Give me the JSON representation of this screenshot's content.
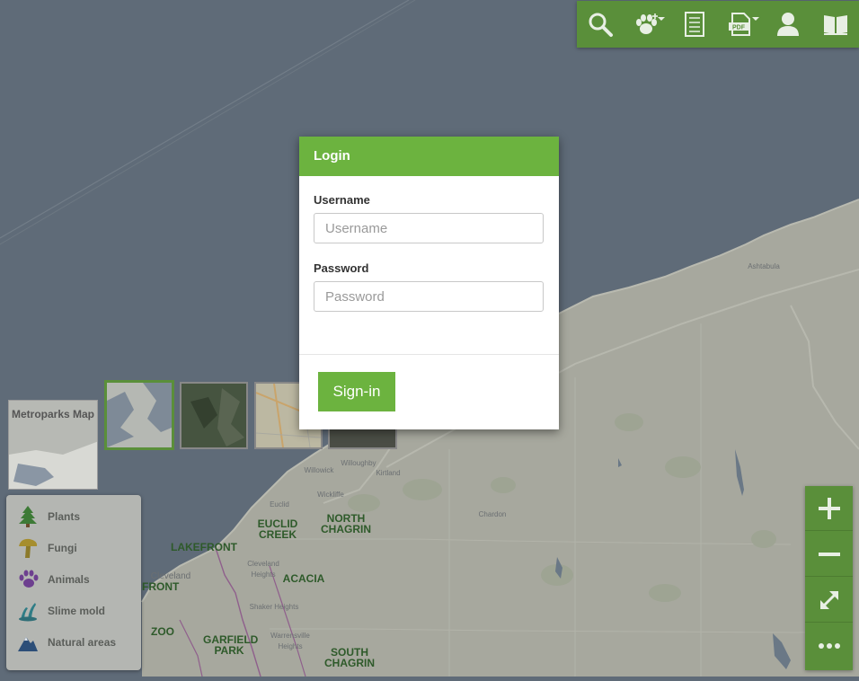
{
  "toolbar": {
    "search_icon": "search-icon",
    "species_icon": "paw-icon",
    "list_icon": "list-icon",
    "pdf_icon": "pdf-icon",
    "user_icon": "user-icon",
    "book_icon": "book-icon"
  },
  "login": {
    "title": "Login",
    "username_label": "Username",
    "username_placeholder": "Username",
    "username_value": "",
    "password_label": "Password",
    "password_placeholder": "Password",
    "password_value": "",
    "signin_label": "Sign-in"
  },
  "basemaps": {
    "metroparks_label": "Metroparks Map"
  },
  "legend": {
    "items": [
      {
        "label": "Plants",
        "icon": "tree-icon"
      },
      {
        "label": "Fungi",
        "icon": "mushroom-icon"
      },
      {
        "label": "Animals",
        "icon": "paw-icon"
      },
      {
        "label": "Slime mold",
        "icon": "slime-mold-icon"
      },
      {
        "label": "Natural areas",
        "icon": "mountain-icon"
      }
    ]
  },
  "map": {
    "labels": {
      "euclid_creek": "EUCLID CREEK",
      "north_chagrin": "NORTH CHAGRIN",
      "lakefront": "LAKEFRONT",
      "acacia": "ACACIA",
      "front": "FRONT",
      "zoo": "ZOO",
      "garfield_park": "GARFIELD PARK",
      "south_chagrin": "SOUTH CHAGRIN",
      "cleveland": "Cleveland",
      "ashtabula": "Ashtabula",
      "chardon": "Chardon",
      "kirtland": "Kirtland",
      "willowick": "Willowick",
      "wickliffe": "Wickliffe",
      "euclid": "Euclid",
      "cleveland_heights": "Cleveland Heights",
      "shaker_heights": "Shaker Heights",
      "warrensville_heights": "Warrensville Heights",
      "willoughby": "Willoughby"
    }
  },
  "colors": {
    "lake": "#5f6b78",
    "land": "#a7a89e",
    "brand_green": "#5a8f3a",
    "login_green": "#6cb33f"
  }
}
